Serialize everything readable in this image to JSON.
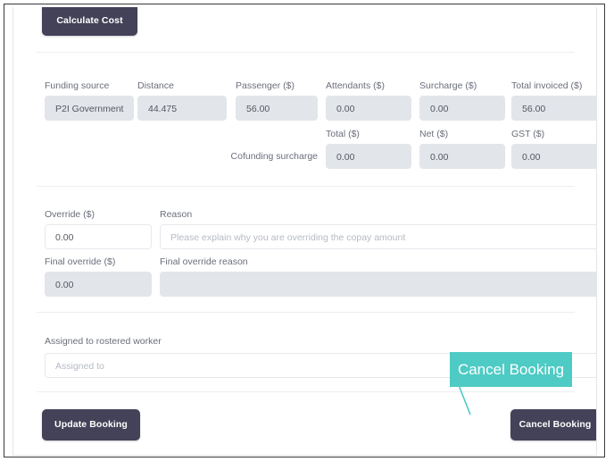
{
  "card": {
    "calculate_cost_label": "Calculate Cost",
    "update_booking_label": "Update Booking",
    "cancel_booking_label": "Cancel Booking"
  },
  "cost_section": {
    "row1": [
      {
        "label": "Funding source",
        "value": "P2I Government"
      },
      {
        "label": "Distance",
        "value": "44.475"
      },
      {
        "label": "Passenger ($)",
        "value": "56.00"
      },
      {
        "label": "Attendants ($)",
        "value": "0.00"
      },
      {
        "label": "Surcharge ($)",
        "value": "0.00"
      },
      {
        "label": "Total invoiced ($)",
        "value": "56.00"
      }
    ],
    "row2_prefix_label": "Cofunding surcharge",
    "row2": [
      {
        "label": "Total ($)",
        "value": "0.00"
      },
      {
        "label": "Net ($)",
        "value": "0.00"
      },
      {
        "label": "GST ($)",
        "value": "0.00"
      }
    ]
  },
  "override_section": {
    "override_label": "Override ($)",
    "override_value": "0.00",
    "reason_label": "Reason",
    "reason_placeholder": "Please explain why you are overriding the copay amount",
    "final_override_label": "Final override ($)",
    "final_override_value": "0.00",
    "final_override_reason_label": "Final override reason",
    "final_override_reason_value": ""
  },
  "assigned_section": {
    "label": "Assigned to rostered worker",
    "placeholder": "Assigned to"
  },
  "callout": {
    "text": "Cancel Booking",
    "color": "#4ecbc4"
  }
}
